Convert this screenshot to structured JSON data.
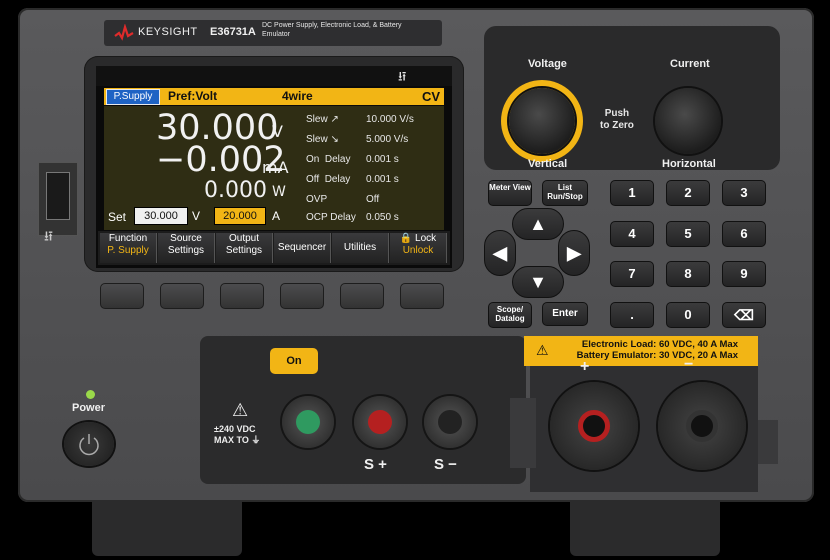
{
  "brand": {
    "name": "KEYSIGHT",
    "model": "E36731A",
    "description": "DC Power Supply, Electronic Load, & Battery Emulator",
    "logo_color": "#e02b2b"
  },
  "display": {
    "mode": "P.Supply",
    "pref": "Pref:Volt",
    "wiring": "4wire",
    "state": "CV",
    "voltage": "30.000",
    "voltage_unit": "V",
    "current": "−0.002",
    "current_unit": "mA",
    "power": "0.000",
    "power_unit": "W",
    "settings": [
      {
        "label": "Slew ↗",
        "value": "10.000 V/s"
      },
      {
        "label": "Slew ↘",
        "value": "5.000 V/s"
      },
      {
        "label": "On  Delay",
        "value": "0.001 s"
      },
      {
        "label": "Off  Delay",
        "value": "0.001 s"
      },
      {
        "label": "OVP",
        "value": "Off"
      },
      {
        "label": "OCP Delay",
        "value": "0.050 s"
      }
    ],
    "set_label": "Set",
    "set_voltage": "30.000",
    "set_voltage_unit": "V",
    "set_current": "20.000",
    "set_current_unit": "A",
    "usb_icon": "usb-icon",
    "accent": "#f2b515",
    "mode_color": "#1f63c4"
  },
  "softkeys": [
    {
      "line1": "Function",
      "line2": "P. Supply"
    },
    {
      "line1": "Source",
      "line2": "Settings"
    },
    {
      "line1": "Output",
      "line2": "Settings"
    },
    {
      "line1": "Sequencer",
      "line2": ""
    },
    {
      "line1": "Utilities",
      "line2": ""
    },
    {
      "line1": "🔒 Lock",
      "line2": "Unlock"
    }
  ],
  "knobs": {
    "voltage": "Voltage",
    "current": "Current",
    "push": "Push\nto Zero",
    "vertical": "Vertical",
    "horizontal": "Horizontal"
  },
  "buttons": {
    "meter_view": "Meter View",
    "list": "List Run/Stop",
    "scope": "Scope/ Datalog",
    "enter": "Enter",
    "on": "On",
    "power": "Power"
  },
  "keypad": [
    "1",
    "2",
    "3",
    "4",
    "5",
    "6",
    "7",
    "8",
    "9",
    ".",
    "0"
  ],
  "terminals": {
    "warning": "±240 VDC\nMAX TO ⏚",
    "sense_plus": "S +",
    "sense_minus": "S −",
    "load_warning": "Electronic Load: 60 VDC, 40 A Max",
    "battery_warning": "Battery Emulator: 30 VDC, 20 A Max",
    "plus": "+",
    "minus": "−"
  }
}
